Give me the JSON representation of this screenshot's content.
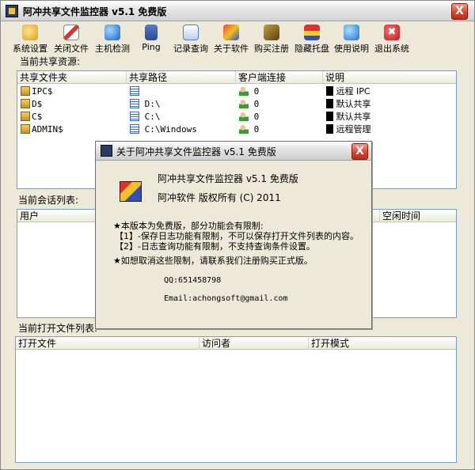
{
  "window": {
    "title": "阿冲共享文件监控器 v5.1 免费版",
    "close_label": "X"
  },
  "toolbar": {
    "buttons": [
      {
        "label": "系统设置",
        "icon": "gear-icon"
      },
      {
        "label": "关闭文件",
        "icon": "close-file-icon"
      },
      {
        "label": "主机检测",
        "icon": "globe-icon"
      },
      {
        "label": "Ping",
        "icon": "network-icon"
      },
      {
        "label": "记录查询",
        "icon": "log-icon"
      },
      {
        "label": "关于软件",
        "icon": "about-icon"
      },
      {
        "label": "购买注册",
        "icon": "key-icon"
      },
      {
        "label": "隐藏托盘",
        "icon": "tray-icon"
      },
      {
        "label": "使用说明",
        "icon": "help-icon"
      },
      {
        "label": "退出系统",
        "icon": "exit-icon",
        "glyph": "✖"
      }
    ]
  },
  "shares": {
    "label": "当前共享资源:",
    "columns": [
      "共享文件夹",
      "共享路径",
      "客户端连接",
      "说明"
    ],
    "rows": [
      {
        "name": "IPC$",
        "path": "",
        "clients": "0",
        "desc": "远程 IPC"
      },
      {
        "name": "D$",
        "path": "D:\\",
        "clients": "0",
        "desc": "默认共享"
      },
      {
        "name": "C$",
        "path": "C:\\",
        "clients": "0",
        "desc": "默认共享"
      },
      {
        "name": "ADMIN$",
        "path": "C:\\Windows",
        "clients": "0",
        "desc": "远程管理"
      }
    ]
  },
  "sessions": {
    "label": "当前会话列表:",
    "columns": [
      "用户",
      "空闲时间"
    ]
  },
  "openfiles": {
    "label": "当前打开文件列表:",
    "columns": [
      "打开文件",
      "访问者",
      "打开模式"
    ]
  },
  "about": {
    "title": "关于阿冲共享文件监控器 v5.1 免费版",
    "close_label": "X",
    "product": "阿冲共享文件监控器 v5.1 免费版",
    "copyright": "阿冲软件 版权所有 (C) 2011",
    "limits_intro": "★本版本为免费版，部分功能会有限制:",
    "limit1": "【1】-保存日志功能有限制，不可以保存打开文件列表的内容。",
    "limit2": "【2】-日志查询功能有限制，不支持查询条件设置。",
    "remove": "★如想取消这些限制，请联系我们注册购买正式版。",
    "qq": "QQ:651458798",
    "email": "Email:achongsoft@gmail.com"
  }
}
